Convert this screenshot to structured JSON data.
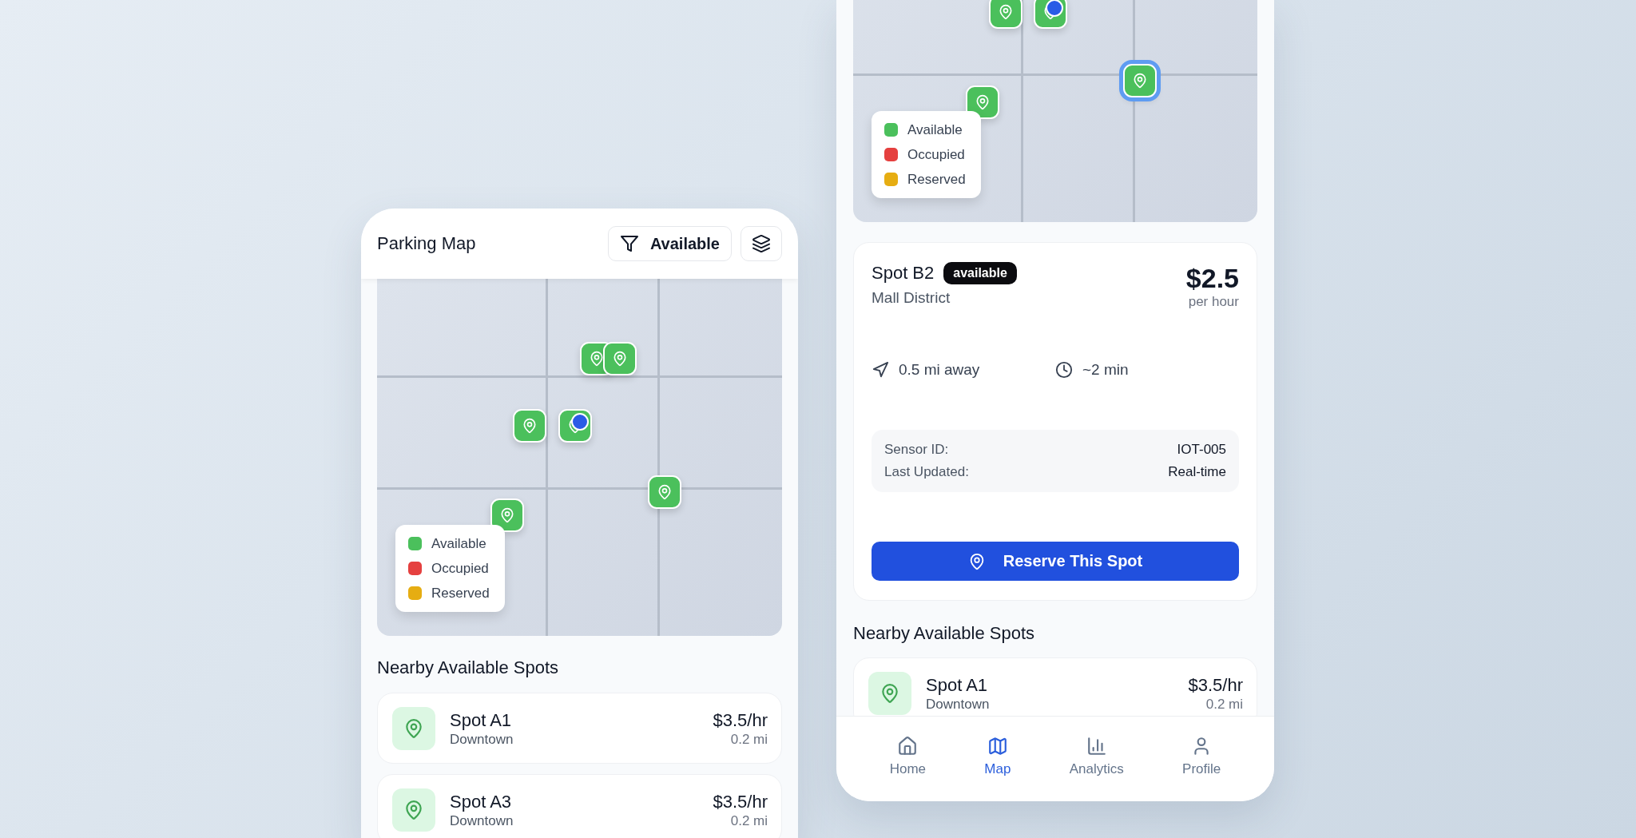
{
  "screens": [
    {
      "kind": "map_home",
      "header": {
        "title": "Parking Map",
        "filter_button": "Available"
      },
      "map": {
        "user_location": true,
        "markers": [
          {
            "color": "#4bc05c",
            "selected": false
          },
          {
            "color": "#4bc05c",
            "selected": false
          },
          {
            "color": "#4bc05c",
            "selected": false
          },
          {
            "color": "#4bc05c",
            "selected": false
          },
          {
            "color": "#4bc05c",
            "selected": false
          },
          {
            "color": "#4bc05c",
            "selected": false
          }
        ],
        "legend": [
          {
            "label": "Available",
            "color": "#4bc05c"
          },
          {
            "label": "Occupied",
            "color": "#e5403f"
          },
          {
            "label": "Reserved",
            "color": "#e6ad12"
          }
        ]
      },
      "nearby": {
        "title": "Nearby Available Spots",
        "spots": [
          {
            "name": "Spot A1",
            "area": "Downtown",
            "price": "$3.5/hr",
            "distance": "0.2 mi"
          },
          {
            "name": "Spot A3",
            "area": "Downtown",
            "price": "$3.5/hr",
            "distance": "0.2 mi"
          }
        ]
      }
    },
    {
      "kind": "spot_detail",
      "map": {
        "user_location": true,
        "markers": [
          {
            "color": "#4bc05c",
            "selected": false
          },
          {
            "color": "#4bc05c",
            "selected": false
          },
          {
            "color": "#4bc05c",
            "selected": true
          },
          {
            "color": "#4bc05c",
            "selected": false
          }
        ],
        "legend": [
          {
            "label": "Available",
            "color": "#4bc05c"
          },
          {
            "label": "Occupied",
            "color": "#e5403f"
          },
          {
            "label": "Reserved",
            "color": "#e6ad12"
          }
        ]
      },
      "spot_detail": {
        "name": "Spot B2",
        "badge": "available",
        "area": "Mall District",
        "price": "$2.5",
        "price_unit": "per hour",
        "distance": "0.5 mi away",
        "eta": "~2 min",
        "sensor": [
          {
            "label": "Sensor ID:",
            "value": "IOT-005"
          },
          {
            "label": "Last Updated:",
            "value": "Real-time"
          }
        ],
        "button": "Reserve This Spot"
      },
      "nearby": {
        "title": "Nearby Available Spots",
        "spots": [
          {
            "name": "Spot A1",
            "area": "Downtown",
            "price": "$3.5/hr",
            "distance": "0.2 mi"
          }
        ]
      },
      "nav": [
        {
          "label": "Home",
          "selected": false
        },
        {
          "label": "Map",
          "selected": true
        },
        {
          "label": "Analytics",
          "selected": false
        },
        {
          "label": "Profile",
          "selected": false
        }
      ]
    }
  ]
}
